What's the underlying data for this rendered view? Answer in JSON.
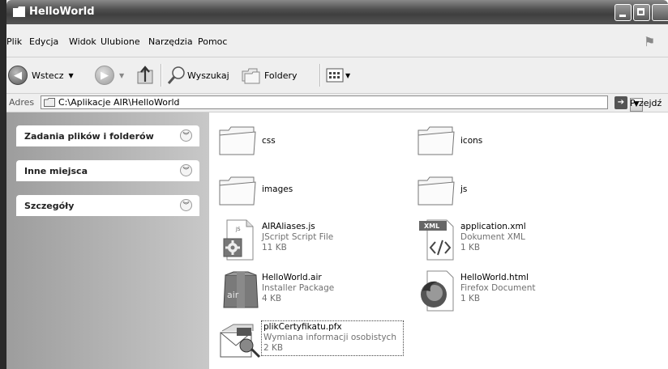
{
  "window": {
    "title": "HelloWorld"
  },
  "menu": [
    "Plik",
    "Edycja",
    "Widok",
    "Ulubione",
    "Narzędzia",
    "Pomoc"
  ],
  "toolbar": {
    "back": "Wstecz",
    "search": "Wyszukaj",
    "folders": "Foldery"
  },
  "address": {
    "label": "Adres",
    "path": "C:\\Aplikacje AIR\\HelloWorld",
    "go": "Przejdź"
  },
  "tasks": [
    "Zadania plików i folderów",
    "Inne miejsca",
    "Szczegóły"
  ],
  "files": [
    {
      "name": "css",
      "type": "",
      "size": "",
      "icon": "folder-icon"
    },
    {
      "name": "icons",
      "type": "",
      "size": "",
      "icon": "folder-icon"
    },
    {
      "name": "images",
      "type": "",
      "size": "",
      "icon": "folder-icon"
    },
    {
      "name": "js",
      "type": "",
      "size": "",
      "icon": "folder-icon"
    },
    {
      "name": "AIRAliases.js",
      "type": "JScript Script File",
      "size": "11 KB",
      "icon": "jscript-file-icon",
      "badge": "JS"
    },
    {
      "name": "application.xml",
      "type": "Dokument XML",
      "size": "1 KB",
      "icon": "xml-file-icon",
      "badge": "XML"
    },
    {
      "name": "HelloWorld.air",
      "type": "Installer Package",
      "size": "4 KB",
      "icon": "air-package-icon",
      "badge": "air"
    },
    {
      "name": "HelloWorld.html",
      "type": "Firefox Document",
      "size": "1 KB",
      "icon": "firefox-document-icon"
    },
    {
      "name": "plikCertyfikatu.pfx",
      "type": "Wymiana informacji osobistych",
      "size": "2 KB",
      "icon": "certificate-file-icon"
    }
  ]
}
